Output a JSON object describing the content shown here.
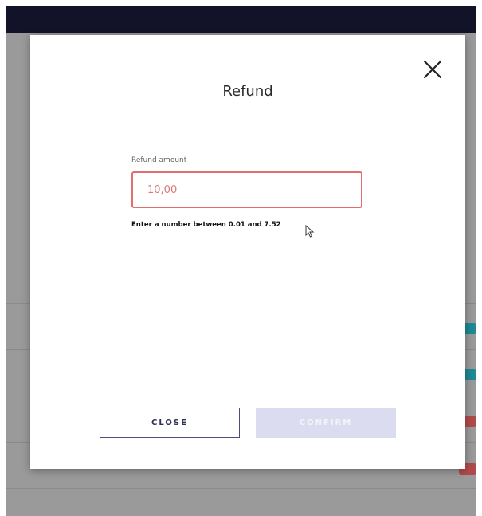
{
  "dialog": {
    "title": "Refund",
    "field_label": "Refund amount",
    "amount_value": "10,00",
    "error_message": "Enter a number between 0.01 and 7.52",
    "close_label": "CLOSE",
    "confirm_label": "CONFIRM"
  },
  "colors": {
    "topbar": "#121329",
    "error_border": "#e46e6e",
    "primary_outline": "#4b4e7e",
    "confirm_disabled": "#dcdcf0"
  },
  "icons": {
    "dialog_close": "close-icon",
    "pointer": "mouse-pointer-icon"
  }
}
